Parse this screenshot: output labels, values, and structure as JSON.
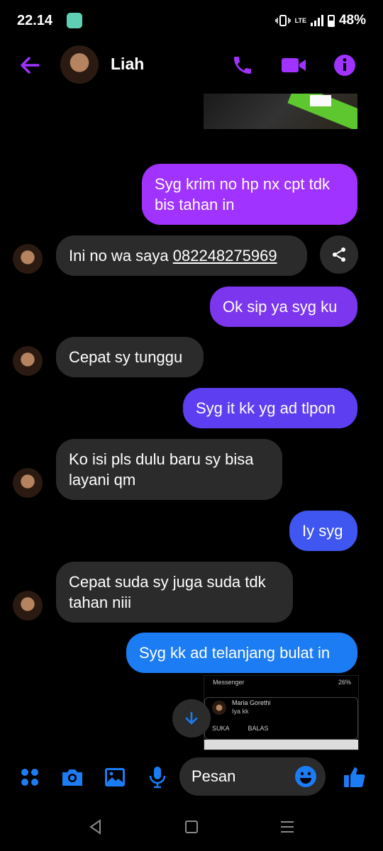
{
  "status_bar": {
    "time": "22.14",
    "network": "LTE",
    "battery": "48%"
  },
  "header": {
    "contact_name": "Liah"
  },
  "colors": {
    "accent": "#a033ff",
    "blue": "#1c7cf4",
    "bubble_in": "#2b2b2b"
  },
  "messages": [
    {
      "side": "out",
      "text": "Syg krim no hp nx cpt tdk bis tahan in"
    },
    {
      "side": "in",
      "text_prefix": "Ini no wa saya ",
      "phone": "082248275969"
    },
    {
      "side": "out",
      "text": "Ok sip ya syg ku"
    },
    {
      "side": "in",
      "text": "Cepat sy tunggu"
    },
    {
      "side": "out",
      "text": "Syg it kk yg ad tlpon"
    },
    {
      "side": "in",
      "text": "Ko isi pls dulu baru sy bisa layani qm"
    },
    {
      "side": "out",
      "text": "Iy syg"
    },
    {
      "side": "in",
      "text": "Cepat suda sy juga suda tdk tahan niii"
    },
    {
      "side": "out",
      "text": "Syg kk ad telanjang bulat in"
    }
  ],
  "screenshot_attachment": {
    "app": "Messenger",
    "battery": "26%",
    "sender": "Maria Gorethi",
    "text": "Iya kk",
    "like": "SUKA",
    "reply": "BALAS"
  },
  "composer": {
    "placeholder": "Pesan"
  }
}
